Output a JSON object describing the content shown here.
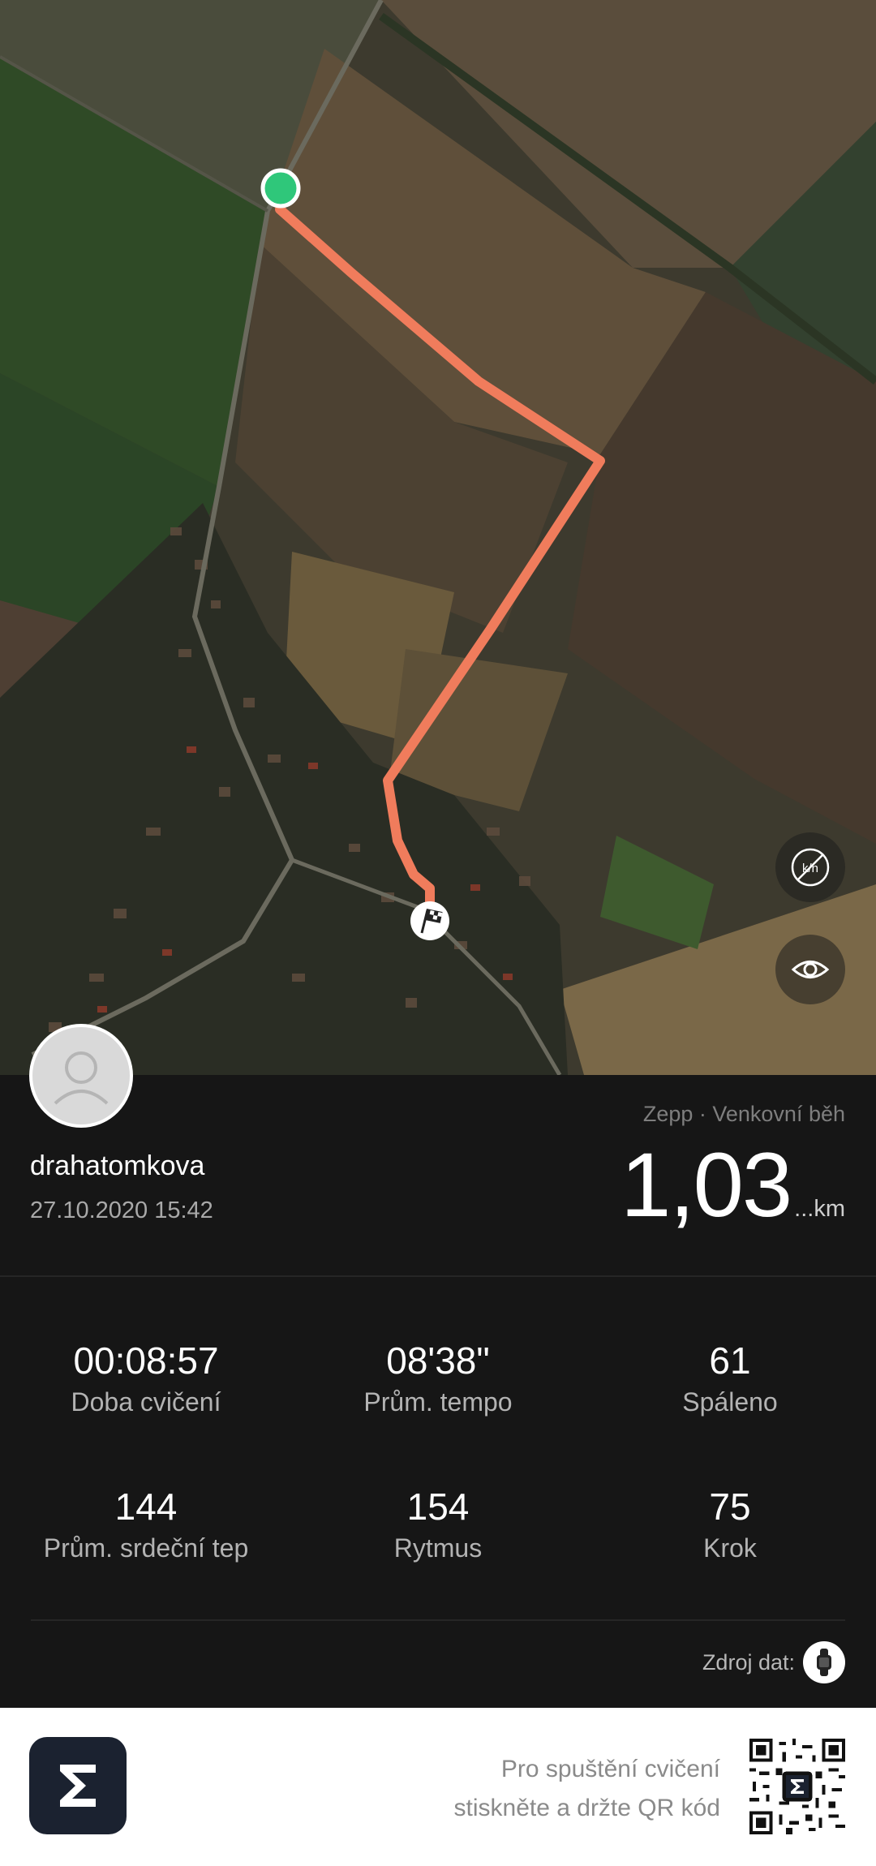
{
  "map": {
    "route_color": "#f07c5c",
    "start_marker_color": "#2fc77a",
    "buttons": [
      {
        "name": "units-toggle-icon"
      },
      {
        "name": "visibility-icon"
      }
    ]
  },
  "summary": {
    "username": "drahatomkova",
    "datetime": "27.10.2020 15:42",
    "source": "Zepp · Venkovní běh",
    "distance_value": "1,03",
    "distance_unit": "...km"
  },
  "stats": [
    {
      "value": "00:08:57",
      "label": "Doba cvičení"
    },
    {
      "value": "08'38\"",
      "label": "Prům. tempo"
    },
    {
      "value": "61",
      "label": "Spáleno"
    },
    {
      "value": "144",
      "label": "Prům. srdeční tep"
    },
    {
      "value": "154",
      "label": "Rytmus"
    },
    {
      "value": "75",
      "label": "Krok"
    }
  ],
  "data_source_label": "Zdroj dat:",
  "footer": {
    "qr_line1": "Pro spuštění cvičení",
    "qr_line2": "stiskněte a držte QR kód"
  }
}
